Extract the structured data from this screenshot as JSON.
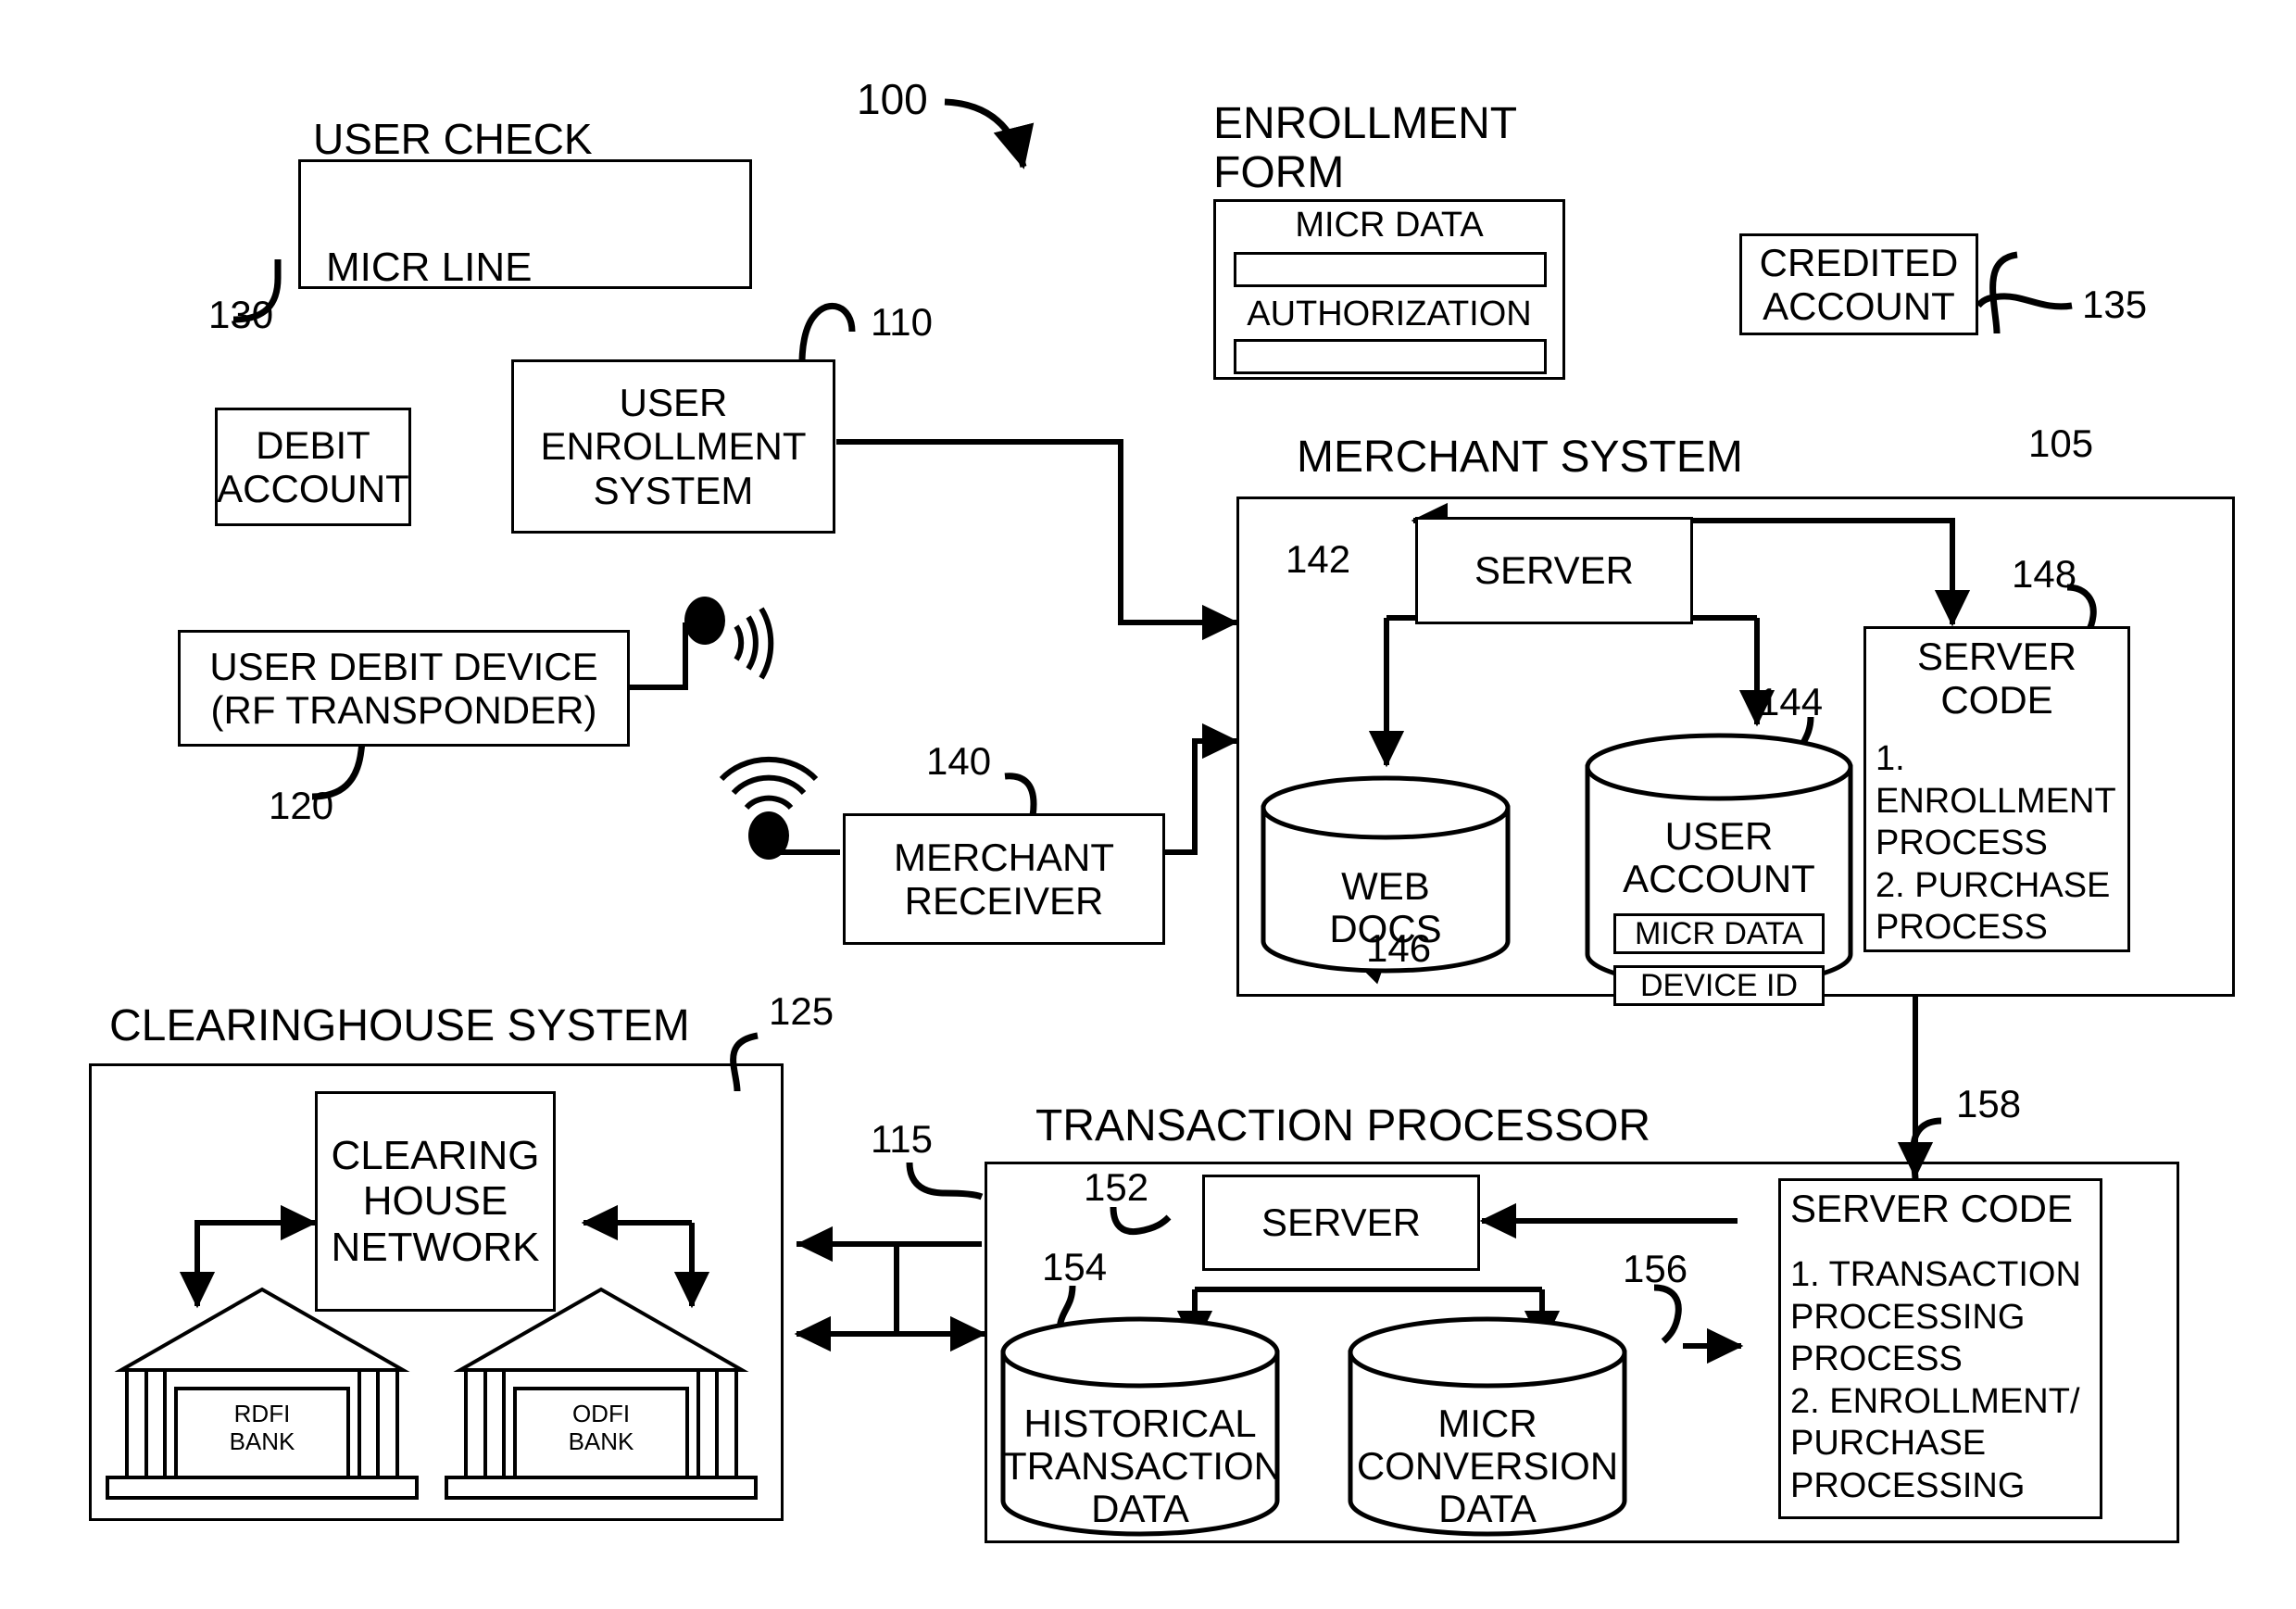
{
  "figure": {
    "ref_main": "100"
  },
  "user_check": {
    "title": "USER CHECK",
    "micr_line_label": "MICR LINE"
  },
  "enrollment_form": {
    "title": "ENROLLMENT\nFORM",
    "micr_data_label": "MICR DATA",
    "authorization_label": "AUTHORIZATION"
  },
  "credited_account": {
    "label": "CREDITED\nACCOUNT",
    "ref": "135"
  },
  "debit_account": {
    "label": "DEBIT\nACCOUNT",
    "ref": "130"
  },
  "user_enrollment_system": {
    "label": "USER\nENROLLMENT\nSYSTEM",
    "ref": "110"
  },
  "user_debit_device": {
    "label": "USER DEBIT DEVICE\n(RF TRANSPONDER)",
    "ref": "120"
  },
  "merchant_receiver": {
    "label": "MERCHANT\nRECEIVER",
    "ref": "140"
  },
  "merchant_system": {
    "title": "MERCHANT SYSTEM",
    "ref": "105",
    "server": {
      "label": "SERVER",
      "ref": "142"
    },
    "web_docs": {
      "label": "WEB\nDOCS",
      "ref": "146"
    },
    "user_account": {
      "label": "USER\nACCOUNT",
      "ref": "144",
      "fields": [
        "MICR DATA",
        "DEVICE ID"
      ]
    },
    "server_code": {
      "ref": "148",
      "title": "SERVER\nCODE",
      "lines": [
        "1.  ENROLLMENT\nPROCESS",
        "2.  PURCHASE\nPROCESS"
      ]
    }
  },
  "clearinghouse_system": {
    "title": "CLEARINGHOUSE SYSTEM",
    "ref": "125",
    "network": {
      "label": "CLEARING\nHOUSE\nNETWORK"
    },
    "banks": [
      {
        "name": "RDFI\nBANK"
      },
      {
        "name": "ODFI\nBANK"
      }
    ]
  },
  "transaction_processor": {
    "title": "TRANSACTION PROCESSOR",
    "ref": "115",
    "server": {
      "label": "SERVER",
      "ref": "152"
    },
    "historical": {
      "label": "HISTORICAL\nTRANSACTION\nDATA",
      "ref": "154"
    },
    "micr_conversion": {
      "label": "MICR\nCONVERSION\nDATA",
      "ref": "156"
    },
    "server_code": {
      "ref": "158",
      "title": "SERVER CODE",
      "lines": [
        "1.  TRANSACTION\nPROCESSING\nPROCESS",
        "2.  ENROLLMENT/\nPURCHASE\nPROCESSING"
      ]
    }
  }
}
